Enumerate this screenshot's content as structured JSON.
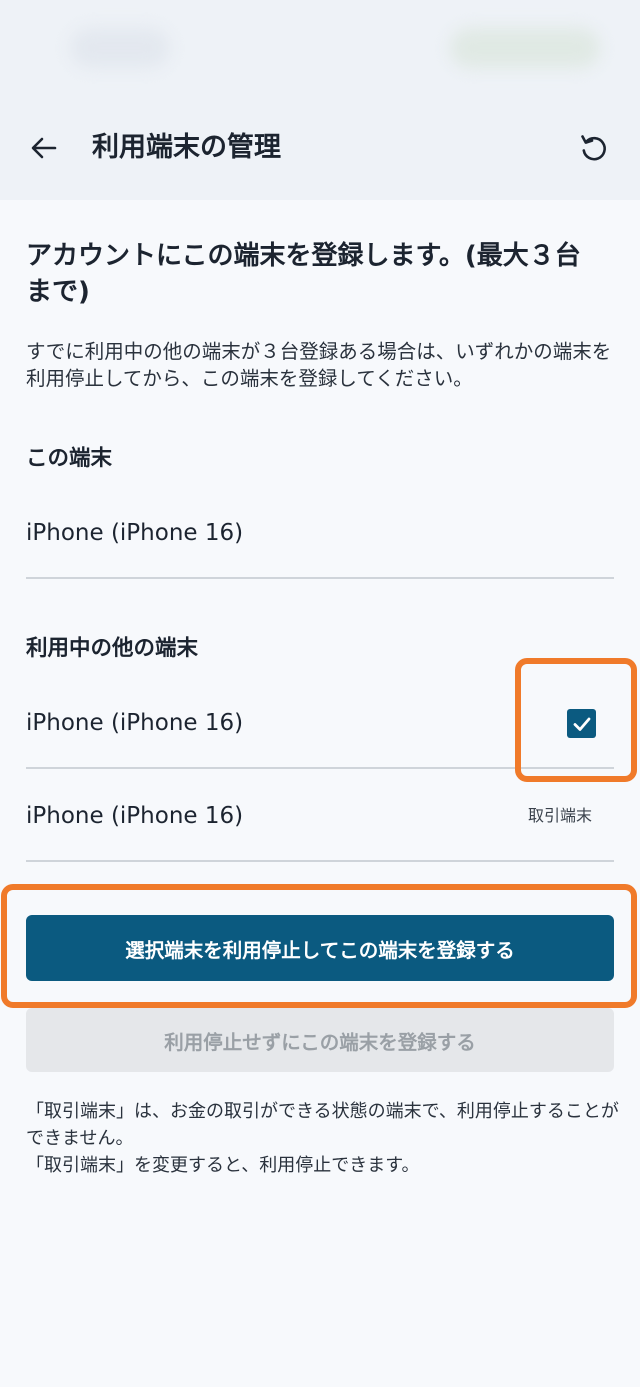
{
  "header": {
    "title": "利用端末の管理",
    "back_icon": "arrow-left-icon",
    "refresh_icon": "refresh-icon"
  },
  "intro": {
    "headline": "アカウントにこの端末を登録します。(最大３台まで)",
    "description": "すでに利用中の他の端末が３台登録ある場合は、いずれかの端末を利用停止してから、この端末を登録してください。"
  },
  "this_device": {
    "label": "この端末",
    "name": "iPhone (iPhone 16)"
  },
  "other_devices": {
    "label": "利用中の他の端末",
    "items": [
      {
        "name": "iPhone (iPhone 16)",
        "selected": true
      },
      {
        "name": "iPhone (iPhone 16)",
        "badge": "取引端末"
      }
    ]
  },
  "actions": {
    "primary_label": "選択端末を利用停止してこの端末を登録する",
    "secondary_label": "利用停止せずにこの端末を登録する"
  },
  "notes": [
    "「取引端末」は、お金の取引ができる状態の端末で、利用停止することができません。",
    "「取引端末」を変更すると、利用停止できます。"
  ],
  "colors": {
    "accent": "#0b5a80",
    "highlight": "#f07a2a",
    "disabled_bg": "#e5e7ea",
    "disabled_text": "#9aa0a6"
  }
}
